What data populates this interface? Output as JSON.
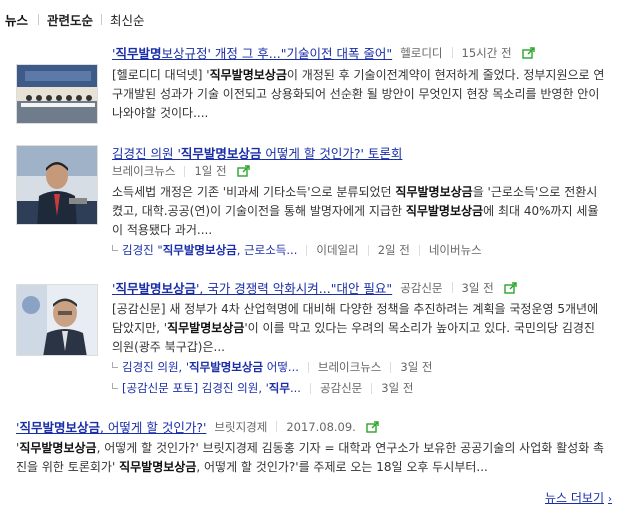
{
  "tabs": [
    {
      "label": "뉴스"
    },
    {
      "label": "관련도순"
    },
    {
      "label": "최신순"
    }
  ],
  "articles": [
    {
      "title_pre": "'",
      "title_bold": "직무발명",
      "title_rest": "보상규정' 개정 그 후...\"기술이전 대폭 줄어\"",
      "source": "헬로디디",
      "time": "15시간 전",
      "desc_pre": "[헬로디디 대덕넷] '",
      "desc_bold": "직무발명보상금",
      "desc_rest": "이 개정된 후 기술이전계약이 현저하게 줄었다. 정부지원으로 연구개발된 성과가 기술 이전되고 상용화되어 선순환 될 방안이 무엇인지 현장 목소리를 반영한 안이 나와야할 것이다...."
    },
    {
      "title_pre": "김경진 의원 '",
      "title_bold": "직무발명보상금",
      "title_rest": " 어떻게 할 것인가?' 토론회",
      "source": "브레이크뉴스",
      "time": "1일 전",
      "desc_pre": "소득세법 개정은 기존 '비과세 기타소득'으로 분류되었던 ",
      "desc_bold": "직무발명보상금",
      "desc_mid": "을 '근로소득'으로 전환시켰고, 대학.공공(연)이 기술이전을 통해 발명자에게 지급한 ",
      "desc_bold2": "직무발명보상금",
      "desc_rest": "에 최대 40%까지 세율이 적용됐다 과거....",
      "related": [
        {
          "title_pre": "김경진 \"",
          "title_bold": "직무발명보상금",
          "title_rest": ", 근로소득...",
          "source": "이데일리",
          "time": "2일 전",
          "extra": "네이버뉴스"
        }
      ]
    },
    {
      "title_pre": "'",
      "title_bold": "직무발명보상금",
      "title_rest": "', 국가 경쟁력 악화시켜...\"대안 필요\"",
      "source": "공감신문",
      "time": "3일 전",
      "desc_pre": "[공감신문] 새 정부가 4차 산업혁명에 대비해 다양한 정책을 추진하려는 계획을 국정운영 5개년에 담았지만, '",
      "desc_bold": "직무발명보상금",
      "desc_rest": "'이 이를 막고 있다는 우려의 목소리가 높아지고 있다. 국민의당 김경진 의원(광주 북구갑)은...",
      "related": [
        {
          "title_pre": "김경진 의원, '",
          "title_bold": "직무발명보상금",
          "title_rest": " 어떻...",
          "source": "브레이크뉴스",
          "time": "3일 전"
        },
        {
          "title_pre": "[공감신문 포토] 김경진 의원, '",
          "title_bold": "직무",
          "title_rest": "...",
          "source": "공감신문",
          "time": "3일 전"
        }
      ]
    },
    {
      "title_pre": "'",
      "title_bold": "직무발명보상금",
      "title_rest": ", 어떻게 할 것인가?'",
      "source": "브릿지경제",
      "time": "2017.08.09.",
      "desc_pre": "'",
      "desc_bold": "직무발명보상금",
      "desc_mid": ", 어떻게 할 것인가?' 브릿지경제 김동홍 기자 = 대학과 연구소가 보유한 공공기술의 사업화 활성화 촉진을 위한 토론회가' ",
      "desc_bold2": "직무발명보상금",
      "desc_rest": ", 어떻게 할 것인가?'를 주제로 오는 18일 오후 두시부터..."
    }
  ],
  "more_label": "뉴스 더보기"
}
